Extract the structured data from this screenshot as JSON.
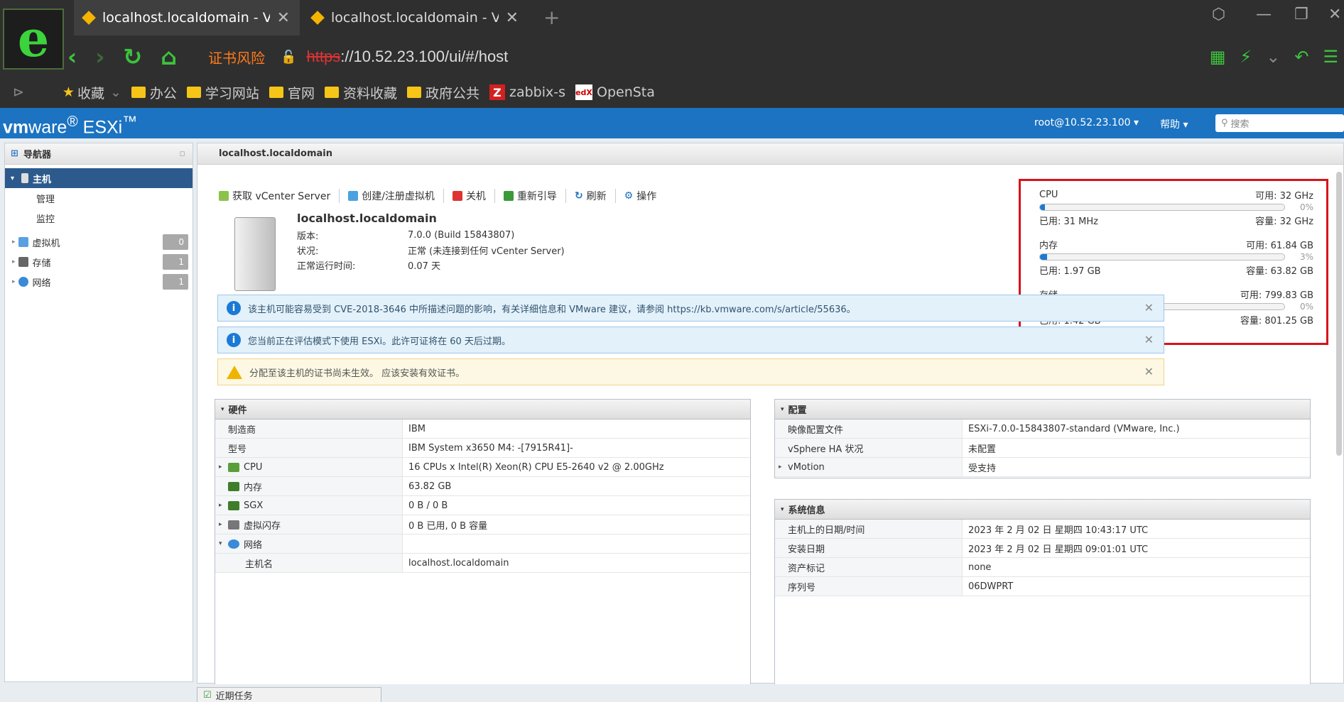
{
  "browser": {
    "tabs": [
      {
        "title": "localhost.localdomain - V",
        "active": true
      },
      {
        "title": "localhost.localdomain - V",
        "active": false
      }
    ],
    "cert_risk": "证书风险",
    "url_scheme": "https",
    "url_rest": "://10.52.23.100/ui/#/host",
    "bookmarks": [
      "收藏",
      "办公",
      "学习网站",
      "官网",
      "资料收藏",
      "政府公共",
      "zabbix-s",
      "OpenSta"
    ]
  },
  "esxi": {
    "brand_vm": "vm",
    "brand_ware": "ware",
    "brand_esxi": "ESXi",
    "user": "root@10.52.23.100 ▾",
    "help": "帮助 ▾",
    "search_placeholder": "搜索"
  },
  "navigator": {
    "title": "导航器",
    "host": "主机",
    "manage": "管理",
    "monitor": "监控",
    "vms": {
      "label": "虚拟机",
      "count": "0"
    },
    "storage": {
      "label": "存储",
      "count": "1"
    },
    "network": {
      "label": "网络",
      "count": "1"
    }
  },
  "content": {
    "title": "localhost.localdomain",
    "toolbar": [
      "获取 vCenter Server",
      "创建/注册虚拟机",
      "关机",
      "重新引导",
      "刷新",
      "操作"
    ],
    "host": {
      "name": "localhost.localdomain",
      "version_label": "版本:",
      "version": "7.0.0 (Build 15843807)",
      "state_label": "状况:",
      "state": "正常 (未连接到任何 vCenter Server)",
      "uptime_label": "正常运行时间:",
      "uptime": "0.07 天"
    },
    "resources": {
      "cpu": {
        "name": "CPU",
        "free": "可用: 32 GHz",
        "pct": "0%",
        "fill": 0.003,
        "used": "已用: 31 MHz",
        "cap": "容量: 32 GHz"
      },
      "mem": {
        "name": "内存",
        "free": "可用: 61.84 GB",
        "pct": "3%",
        "fill": 0.03,
        "used": "已用: 1.97 GB",
        "cap": "容量: 63.82 GB"
      },
      "storage": {
        "name": "存储",
        "free": "可用: 799.83 GB",
        "pct": "0%",
        "fill": 0.002,
        "used": "已用: 1.42 GB",
        "cap": "容量: 801.25 GB"
      }
    },
    "alerts": [
      "该主机可能容易受到 CVE-2018-3646 中所描述问题的影响，有关详细信息和 VMware 建议，请参阅 https://kb.vmware.com/s/article/55636。",
      "您当前正在评估模式下使用 ESXi。此许可证将在 60 天后过期。",
      "分配至该主机的证书尚未生效。 应该安装有效证书。"
    ],
    "hardware": {
      "title": "硬件",
      "rows": [
        {
          "k": "制造商",
          "v": "IBM"
        },
        {
          "k": "型号",
          "v": "IBM System x3650 M4: -[7915R41]-"
        },
        {
          "k": "CPU",
          "v": "16 CPUs x Intel(R) Xeon(R) CPU E5-2640 v2 @ 2.00GHz"
        },
        {
          "k": "内存",
          "v": "63.82 GB"
        },
        {
          "k": "SGX",
          "v": "0 B / 0 B"
        },
        {
          "k": "虚拟闪存",
          "v": "0 B 已用, 0 B 容量"
        },
        {
          "k": "网络",
          "v": ""
        },
        {
          "k": "主机名",
          "v": "localhost.localdomain"
        }
      ]
    },
    "config": {
      "title": "配置",
      "rows": [
        {
          "k": "映像配置文件",
          "v": "ESXi-7.0.0-15843807-standard (VMware, Inc.)"
        },
        {
          "k": "vSphere HA 状况",
          "v": "未配置"
        },
        {
          "k": "vMotion",
          "v": "受支持"
        }
      ]
    },
    "sysinfo": {
      "title": "系统信息",
      "rows": [
        {
          "k": "主机上的日期/时间",
          "v": "2023 年 2 月 02 日 星期四 10:43:17 UTC"
        },
        {
          "k": "安装日期",
          "v": "2023 年 2 月 02 日 星期四 09:01:01 UTC"
        },
        {
          "k": "资产标记",
          "v": "none"
        },
        {
          "k": "序列号",
          "v": "06DWPRT"
        }
      ]
    },
    "recent_tasks": "近期任务"
  }
}
